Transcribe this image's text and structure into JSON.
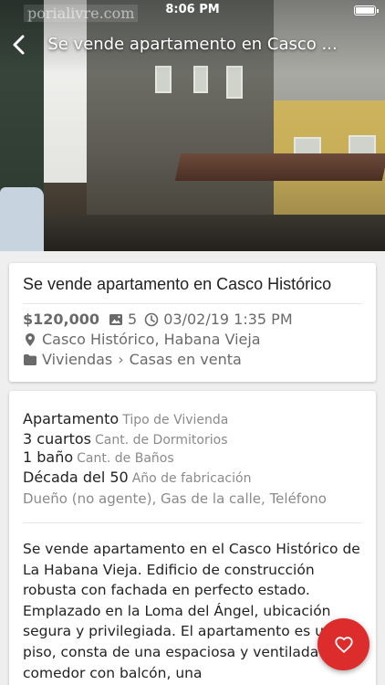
{
  "status_bar": {
    "carrier_watermark": "porialivre.com",
    "time": "8:06 PM"
  },
  "nav": {
    "title": "Se vende apartamento en Casco ..."
  },
  "listing": {
    "title": "Se vende apartamento en Casco Histórico",
    "price": "$120,000",
    "photo_count": "5",
    "date": "03/02/19 1:35 PM",
    "location": "Casco Histórico, Habana Vieja",
    "category": "Viviendas",
    "category_separator": "›",
    "subcategory": "Casas en venta"
  },
  "features": [
    {
      "value": "Apartamento",
      "label": "Tipo de Vivienda"
    },
    {
      "value": "3 cuartos",
      "label": "Cant. de Dormitorios"
    },
    {
      "value": "1 baño",
      "label": "Cant. de Baños"
    },
    {
      "value": "Década del 50",
      "label": "Año de fabricación"
    }
  ],
  "amenities": "Dueño (no agente), Gas de la calle, Teléfono",
  "description": "Se vende apartamento en el Casco Histórico de La Habana Vieja. Edificio de construcción robusta con fachada en perfecto estado. Emplazado en la Loma del Ángel, ubicación segura y privilegiada. El apartamento es un 2do piso, consta de una espaciosa y ventilada sala-comedor con balcón, una",
  "icons": {
    "photos": "image-icon",
    "date": "clock-icon",
    "location": "location-pin-icon",
    "category": "folder-icon",
    "favorite": "heart-icon"
  },
  "colors": {
    "fab": "#dd2c2c",
    "muted_text": "#6a6a6a"
  }
}
